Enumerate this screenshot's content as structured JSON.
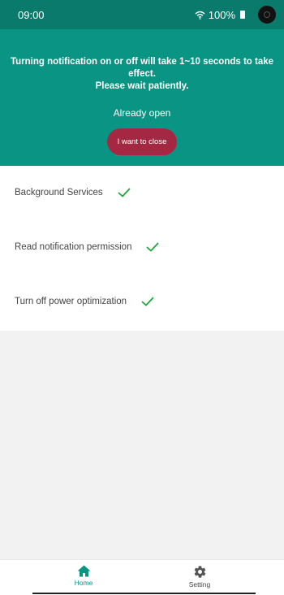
{
  "status_bar": {
    "time": "09:00",
    "battery": "100%",
    "icons": [
      "wifi-icon",
      "battery-icon",
      "camera-icon"
    ]
  },
  "header": {
    "notice_line1": "Turning notification on or off will take 1~10 seconds to take",
    "notice_line2": "effect.",
    "notice_line3": "Please wait patiently.",
    "state": "Already open",
    "action_label": "I want to close",
    "background_color": "#0a9483",
    "action_color": "#a52843"
  },
  "permissions": [
    {
      "label": "Background Services",
      "status": "check-icon"
    },
    {
      "label": "Read notification permission",
      "status": "check-icon"
    },
    {
      "label": "Turn off power optimization",
      "status": "check-icon"
    }
  ],
  "bottom_nav": {
    "items": [
      {
        "label": "Home",
        "icon": "home-icon",
        "active": true
      },
      {
        "label": "Setting",
        "icon": "gear-icon",
        "active": false
      }
    ]
  },
  "colors": {
    "check": "#1ea83a",
    "active_tab": "#0a9483"
  }
}
